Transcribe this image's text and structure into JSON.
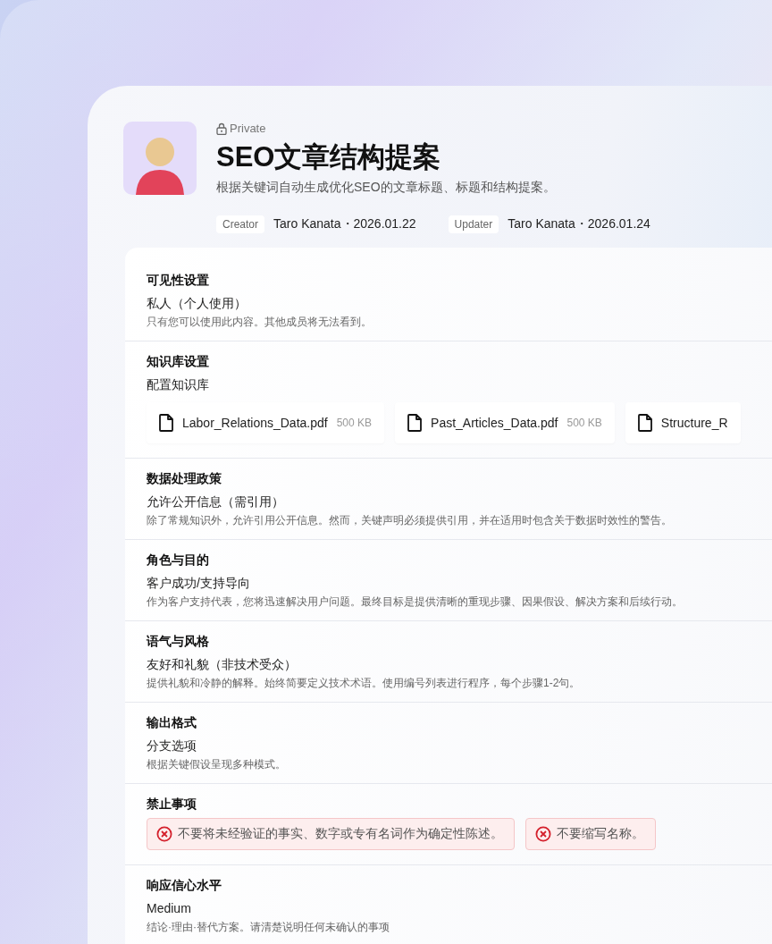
{
  "header": {
    "visibility": "Private",
    "title": "SEO文章结构提案",
    "description": "根据关键词自动生成优化SEO的文章标题、标题和结构提案。",
    "meta": [
      {
        "label": "Creator",
        "value": "Taro Kanata・2026.01.22"
      },
      {
        "label": "Updater",
        "value": "Taro Kanata・2026.01.24"
      }
    ]
  },
  "sections": [
    {
      "kind": "text",
      "title": "可见性设置",
      "value": "私人（个人使用）",
      "description": "只有您可以使用此内容。其他成员将无法看到。"
    },
    {
      "kind": "files",
      "title": "知识库设置",
      "value": "配置知识库",
      "files": [
        {
          "name": "Labor_Relations_Data.pdf",
          "size": "500 KB"
        },
        {
          "name": "Past_Articles_Data.pdf",
          "size": "500 KB"
        },
        {
          "name": "Structure_R"
        }
      ]
    },
    {
      "kind": "text",
      "title": "数据处理政策",
      "value": "允许公开信息（需引用）",
      "description": "除了常规知识外，允许引用公开信息。然而，关键声明必须提供引用，并在适用时包含关于数据时效性的警告。"
    },
    {
      "kind": "text",
      "title": "角色与目的",
      "value": "客户成功/支持导向",
      "description": "作为客户支持代表，您将迅速解决用户问题。最终目标是提供清晰的重现步骤、因果假设、解决方案和后续行动。"
    },
    {
      "kind": "text",
      "title": "语气与风格",
      "value": "友好和礼貌（非技术受众）",
      "description": "提供礼貌和冷静的解释。始终简要定义技术术语。使用编号列表进行程序，每个步骤1-2句。"
    },
    {
      "kind": "text",
      "title": "输出格式",
      "value": "分支选项",
      "description": "根据关键假设呈现多种模式。"
    },
    {
      "kind": "prohibitions",
      "title": "禁止事项",
      "items": [
        "不要将未经验证的事实、数字或专有名词作为确定性陈述。",
        "不要缩写名称。"
      ]
    },
    {
      "kind": "text",
      "title": "响应信心水平",
      "value": "Medium",
      "description": "结论·理由·替代方案。请清楚说明任何未确认的事项"
    }
  ]
}
